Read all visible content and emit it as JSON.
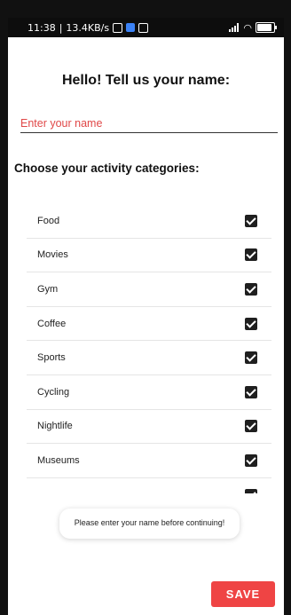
{
  "status_bar": {
    "time": "11:38",
    "network_speed": "13.4KB/s",
    "battery": "88"
  },
  "header": {
    "title": "Hello! Tell us your name:"
  },
  "name_field": {
    "value": "",
    "placeholder": "Enter your name"
  },
  "categories_section": {
    "title": "Choose your activity categories:",
    "items": [
      {
        "label": "Food",
        "checked": true
      },
      {
        "label": "Movies",
        "checked": true
      },
      {
        "label": "Gym",
        "checked": true
      },
      {
        "label": "Coffee",
        "checked": true
      },
      {
        "label": "Sports",
        "checked": true
      },
      {
        "label": "Cycling",
        "checked": true
      },
      {
        "label": "Nightlife",
        "checked": true
      },
      {
        "label": "Museums",
        "checked": true
      },
      {
        "label": "",
        "checked": true
      }
    ]
  },
  "toast": {
    "message": "Please enter your name before continuing!"
  },
  "actions": {
    "save_label": "SAVE"
  },
  "colors": {
    "accent": "#ef4444",
    "placeholder": "#e04848",
    "checkbox": "#1f1f1f"
  }
}
